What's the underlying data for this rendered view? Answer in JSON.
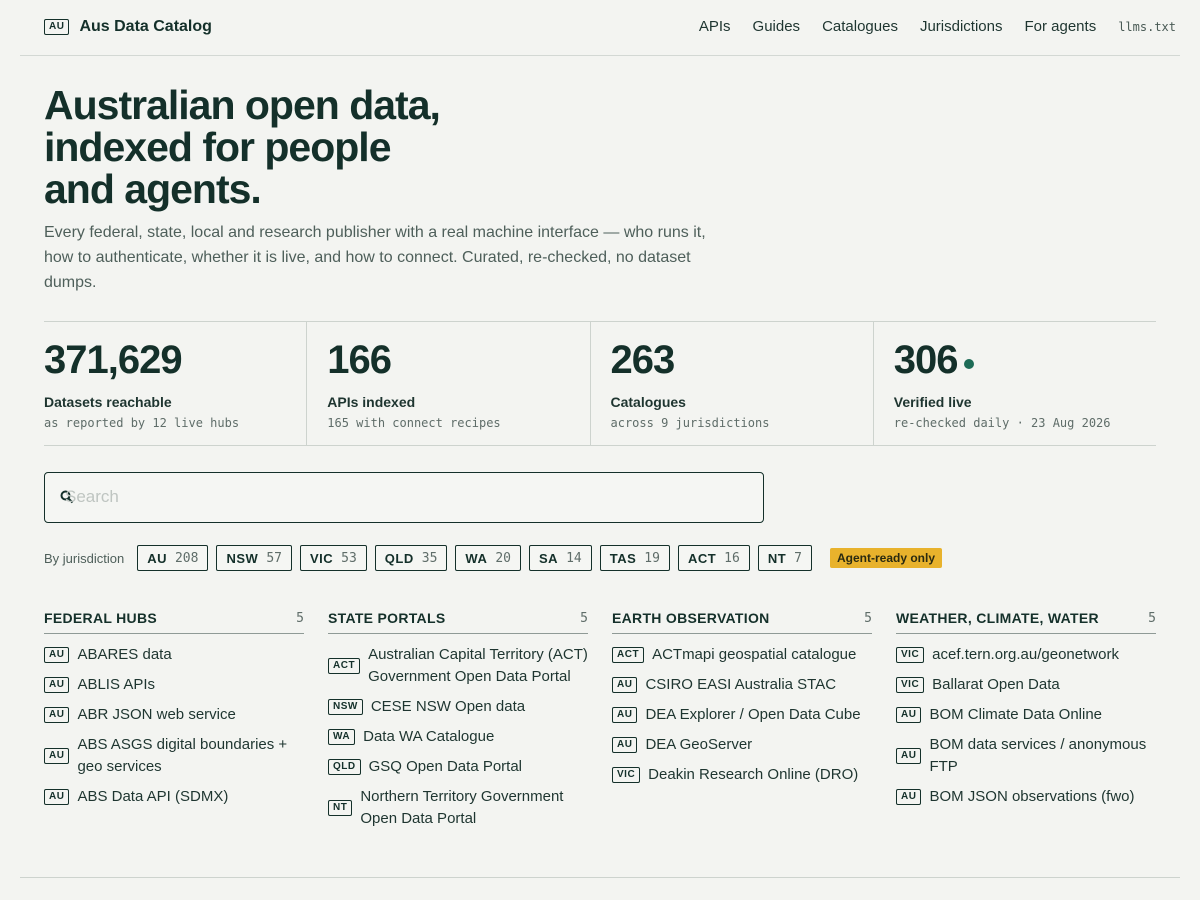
{
  "header": {
    "badge": "AU",
    "brand": "Aus Data Catalog",
    "nav": [
      "APIs",
      "Guides",
      "Catalogues",
      "Jurisdictions",
      "For agents"
    ],
    "llms_link": "llms.txt"
  },
  "hero": {
    "title": "Australian open data, indexed for people and agents.",
    "subtitle": "Every federal, state, local and research publisher with a real machine interface — who runs it, how to authenticate, whether it is live, and how to connect. Curated, re-checked, no dataset dumps."
  },
  "stats": [
    {
      "value": "371,629",
      "label": "Datasets reachable",
      "note": "as reported by 12 live hubs"
    },
    {
      "value": "166",
      "label": "APIs indexed",
      "note": "165 with connect recipes"
    },
    {
      "value": "263",
      "label": "Catalogues",
      "note": "across 9 jurisdictions"
    },
    {
      "value": "306",
      "label": "Verified live",
      "note": "re-checked daily · 23 Aug 2026"
    }
  ],
  "search": {
    "placeholder": "Search",
    "value": ""
  },
  "filters": {
    "label": "By jurisdiction",
    "jurisdictions": [
      {
        "code": "AU",
        "count": "208"
      },
      {
        "code": "NSW",
        "count": "57"
      },
      {
        "code": "VIC",
        "count": "53"
      },
      {
        "code": "QLD",
        "count": "35"
      },
      {
        "code": "WA",
        "count": "20"
      },
      {
        "code": "SA",
        "count": "14"
      },
      {
        "code": "TAS",
        "count": "19"
      },
      {
        "code": "ACT",
        "count": "16"
      },
      {
        "code": "NT",
        "count": "7"
      }
    ],
    "agent_toggle": "Agent-ready only",
    "agent_toggle_color": "#e8b22c"
  },
  "categories": [
    {
      "title": "FEDERAL HUBS",
      "count": "5",
      "items": [
        {
          "tag": "AU",
          "name": "ABARES data"
        },
        {
          "tag": "AU",
          "name": "ABLIS APIs"
        },
        {
          "tag": "AU",
          "name": "ABR JSON web service"
        },
        {
          "tag": "AU",
          "name": "ABS ASGS digital boundaries + geo services"
        },
        {
          "tag": "AU",
          "name": "ABS Data API (SDMX)"
        }
      ]
    },
    {
      "title": "STATE PORTALS",
      "count": "5",
      "items": [
        {
          "tag": "ACT",
          "name": "Australian Capital Territory (ACT) Government Open Data Portal"
        },
        {
          "tag": "NSW",
          "name": "CESE NSW Open data"
        },
        {
          "tag": "WA",
          "name": "Data WA Catalogue"
        },
        {
          "tag": "QLD",
          "name": "GSQ Open Data Portal"
        },
        {
          "tag": "NT",
          "name": "Northern Territory Government Open Data Portal"
        }
      ]
    },
    {
      "title": "EARTH OBSERVATION",
      "count": "5",
      "items": [
        {
          "tag": "ACT",
          "name": "ACTmapi geospatial catalogue"
        },
        {
          "tag": "AU",
          "name": "CSIRO EASI Australia STAC"
        },
        {
          "tag": "AU",
          "name": "DEA Explorer / Open Data Cube"
        },
        {
          "tag": "AU",
          "name": "DEA GeoServer"
        },
        {
          "tag": "VIC",
          "name": "Deakin Research Online (DRO)"
        }
      ]
    },
    {
      "title": "WEATHER, CLIMATE, WATER",
      "count": "5",
      "items": [
        {
          "tag": "VIC",
          "name": "acef.tern.org.au/geonetwork"
        },
        {
          "tag": "VIC",
          "name": "Ballarat Open Data"
        },
        {
          "tag": "AU",
          "name": "BOM Climate Data Online"
        },
        {
          "tag": "AU",
          "name": "BOM data services / anonymous FTP"
        },
        {
          "tag": "AU",
          "name": "BOM JSON observations (fwo)"
        }
      ]
    }
  ],
  "colors": {
    "background": "#f3f4f1",
    "ink": "#14302a",
    "live_dot": "#1d6b56"
  }
}
